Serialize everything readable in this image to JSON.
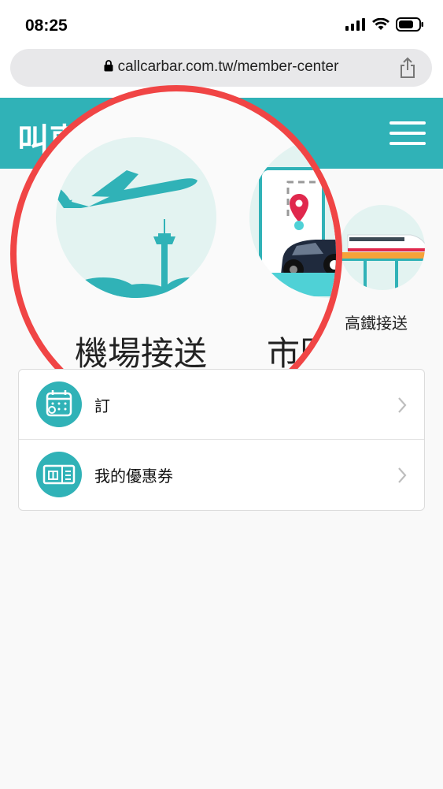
{
  "status_bar": {
    "time": "08:25"
  },
  "browser": {
    "url": "callcarbar.com.tw/member-center"
  },
  "app": {
    "logo_text": "叫車"
  },
  "services": [
    {
      "label": "機場接送",
      "icon": "airplane-tower-icon"
    },
    {
      "label": "市區",
      "icon": "phone-car-map-icon"
    },
    {
      "label": "高鐵接送",
      "icon": "high-speed-rail-icon"
    }
  ],
  "menu_items": [
    {
      "label": "訂",
      "icon": "calendar-icon"
    },
    {
      "label": "我的優惠券",
      "icon": "coupon-icon"
    }
  ],
  "colors": {
    "brand": "#30b2b7",
    "magnifier_ring": "#f04545",
    "teal_light": "#e3f3f1"
  }
}
